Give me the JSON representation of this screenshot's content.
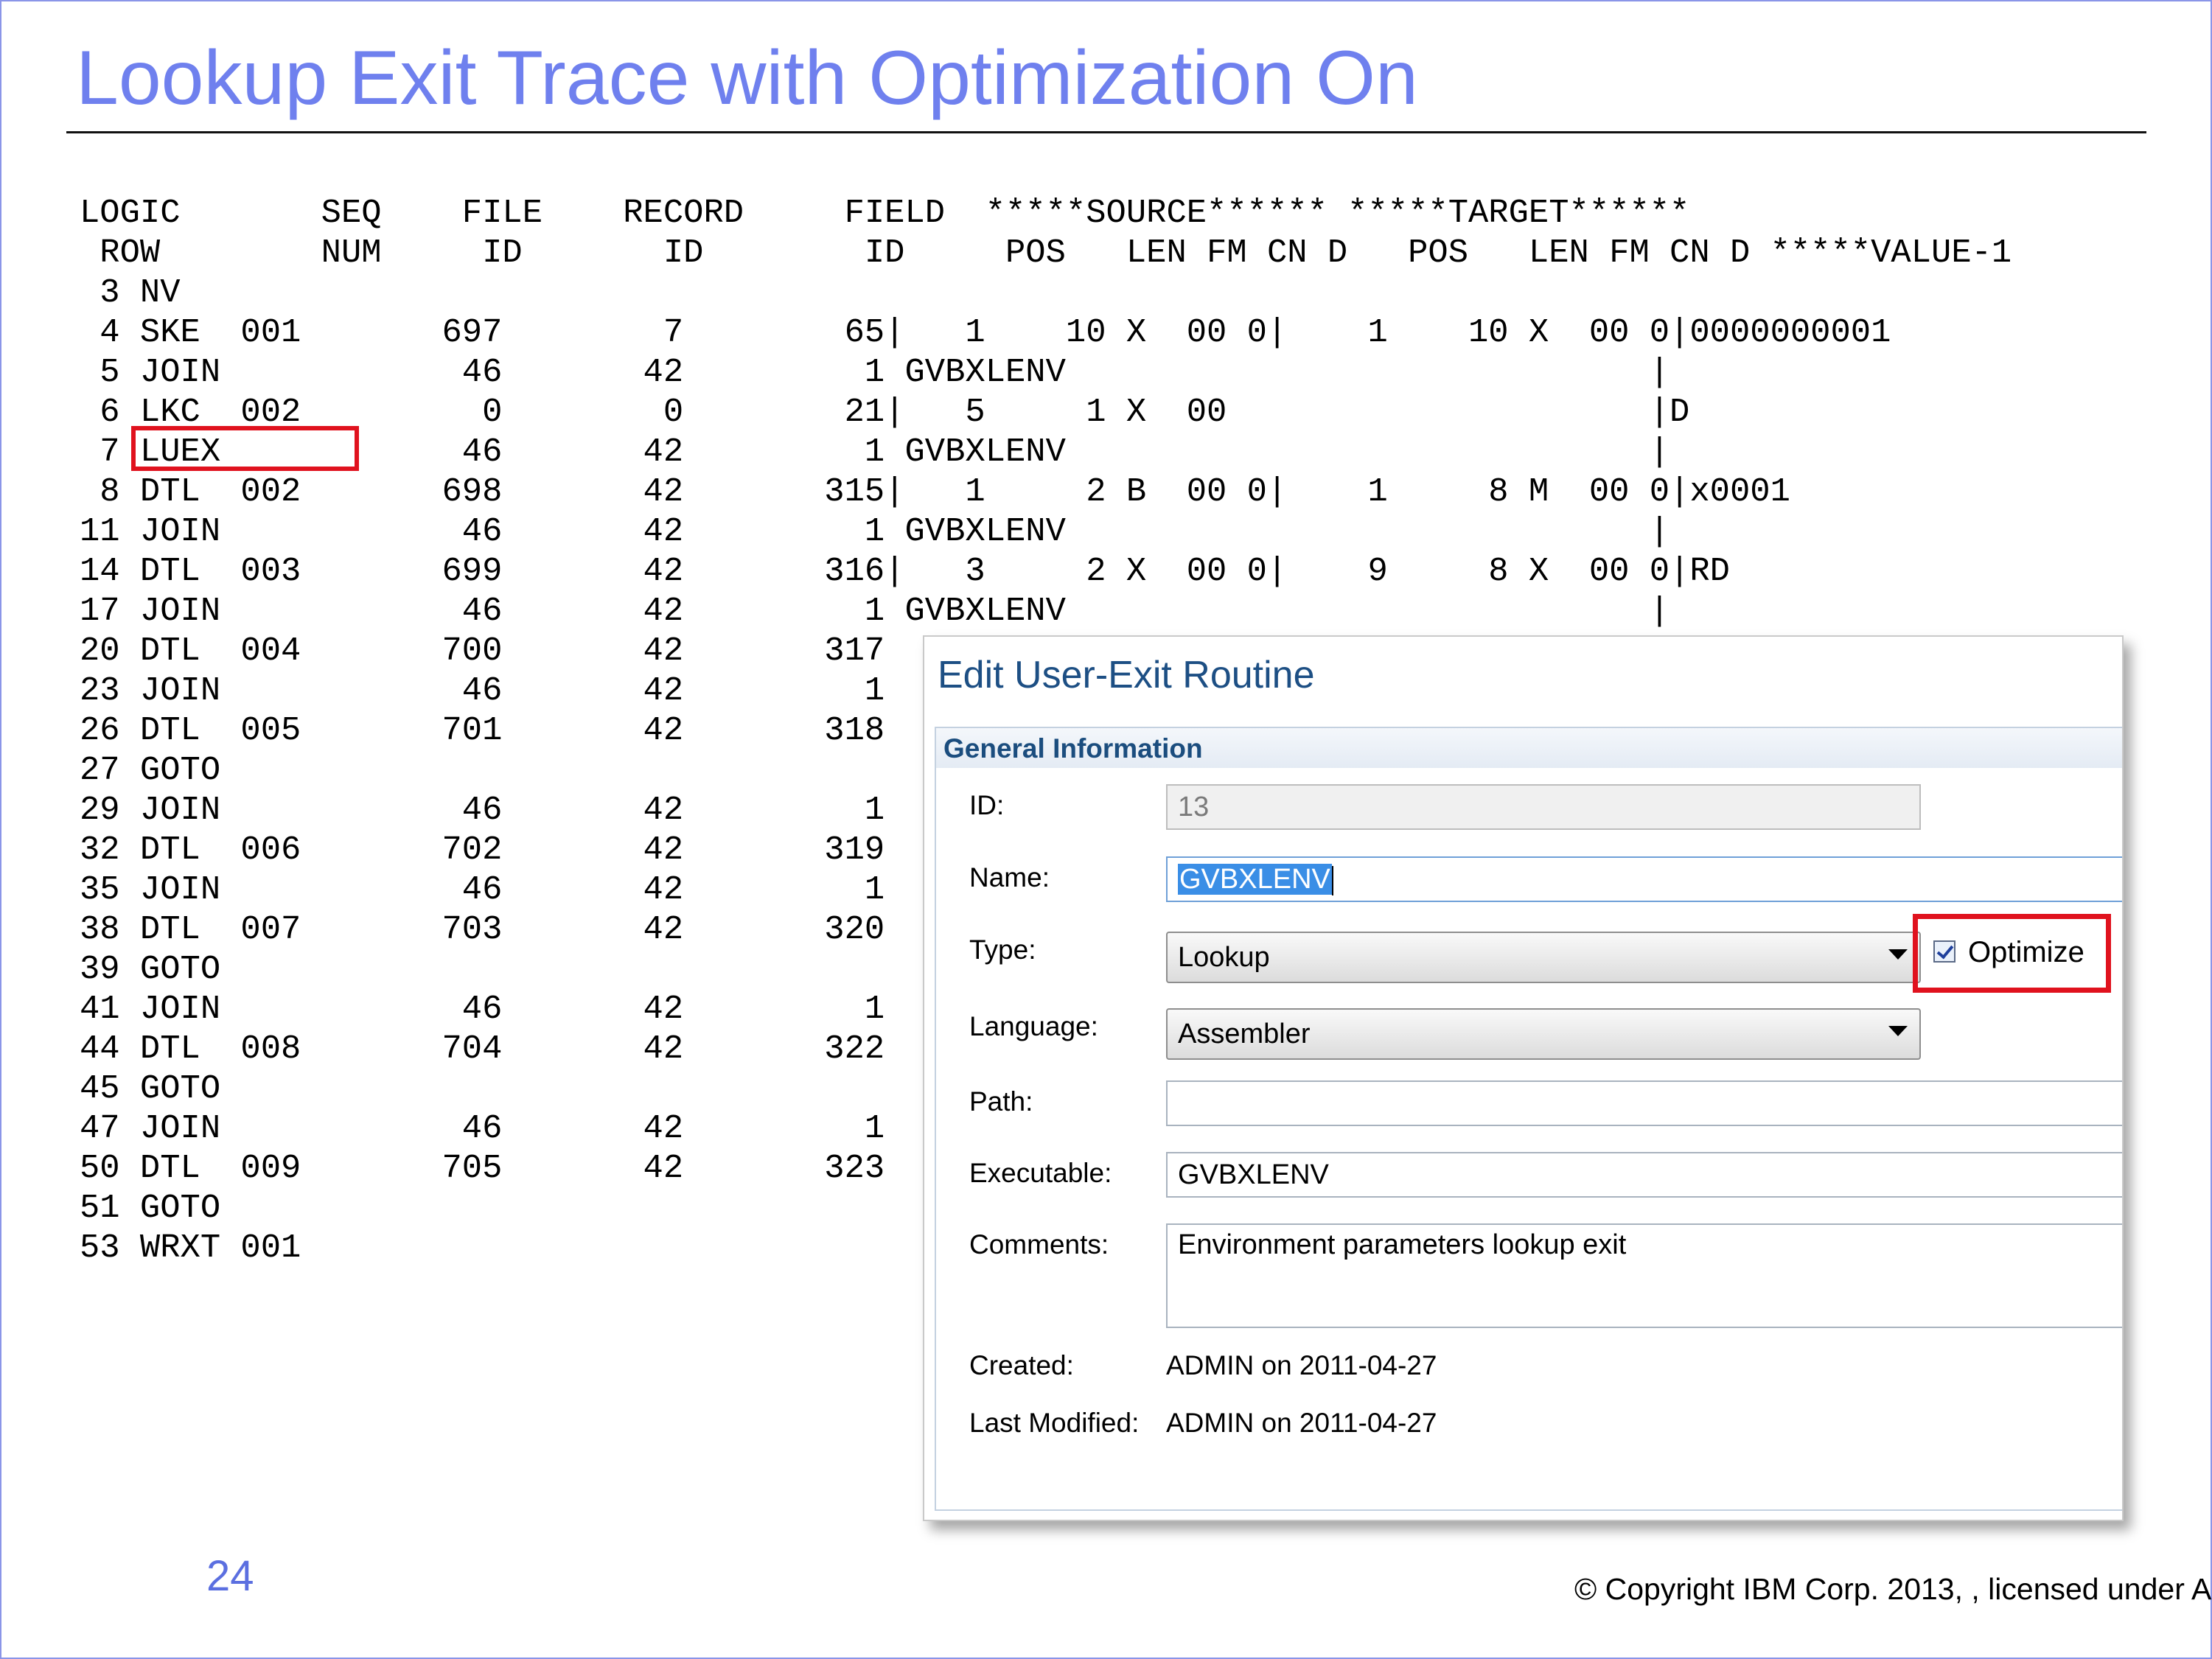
{
  "slide": {
    "title": "Lookup Exit Trace with Optimization On",
    "page_number": "24",
    "copyright": "© Copyright IBM Corp. 2013, , licensed under A"
  },
  "trace": {
    "lines": [
      "LOGIC       SEQ    FILE    RECORD     FIELD  *****SOURCE****** *****TARGET******",
      " ROW        NUM     ID       ID        ID     POS   LEN FM CN D   POS   LEN FM CN D *****VALUE-1",
      " 3 NV",
      " 4 SKE  001       697        7        65|   1    10 X  00 0|    1    10 X  00 0|0000000001",
      " 5 JOIN            46       42         1 GVBXLENV                             |",
      " 6 LKC  002         0        0        21|   5     1 X  00                     |D",
      " 7 LUEX            46       42         1 GVBXLENV                             |",
      " 8 DTL  002       698       42       315|   1     2 B  00 0|    1     8 M  00 0|x0001",
      "11 JOIN            46       42         1 GVBXLENV                             |",
      "14 DTL  003       699       42       316|   3     2 X  00 0|    9     8 X  00 0|RD",
      "17 JOIN            46       42         1 GVBXLENV                             |",
      "20 DTL  004       700       42       317",
      "23 JOIN            46       42         1",
      "26 DTL  005       701       42       318",
      "27 GOTO",
      "29 JOIN            46       42         1",
      "32 DTL  006       702       42       319",
      "35 JOIN            46       42         1",
      "38 DTL  007       703       42       320",
      "39 GOTO",
      "41 JOIN            46       42         1",
      "44 DTL  008       704       42       322",
      "45 GOTO",
      "47 JOIN            46       42         1",
      "50 DTL  009       705       42       323",
      "51 GOTO",
      "53 WRXT 001"
    ]
  },
  "dialog": {
    "title": "Edit User-Exit Routine",
    "section_title": "General Information",
    "labels": {
      "id": "ID:",
      "name": "Name:",
      "type": "Type:",
      "language": "Language:",
      "path": "Path:",
      "executable": "Executable:",
      "comments": "Comments:",
      "created": "Created:",
      "last_modified": "Last Modified:"
    },
    "values": {
      "id": "13",
      "name": "GVBXLENV",
      "type": "Lookup",
      "language": "Assembler",
      "path": "",
      "executable": "GVBXLENV",
      "comments": "Environment parameters lookup exit",
      "created": "ADMIN on 2011-04-27",
      "last_modified": "ADMIN on 2011-04-27"
    },
    "optimize": {
      "label": "Optimize",
      "checked": true
    }
  },
  "colors": {
    "title": "#6f80ee",
    "highlight_box": "#e0121e",
    "dialog_title": "#1d4f84",
    "selection": "#3a8ee6"
  }
}
